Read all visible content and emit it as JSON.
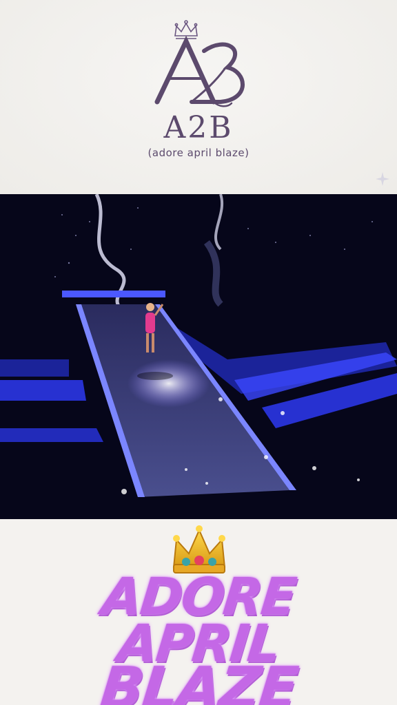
{
  "logo": {
    "title": "A2B",
    "subtitle": "(adore april blaze)"
  },
  "graffiti": {
    "line1": "ADORE",
    "line2": "APRIL",
    "line3": "BLAZE"
  },
  "icons": [
    "crown-icon",
    "sparkle-icon",
    "crown-emoji-icon"
  ],
  "colors": {
    "logo_purple": "#5c4a6d",
    "graffiti_purple": "#c468e6",
    "stage_blue": "#2f3cff"
  }
}
